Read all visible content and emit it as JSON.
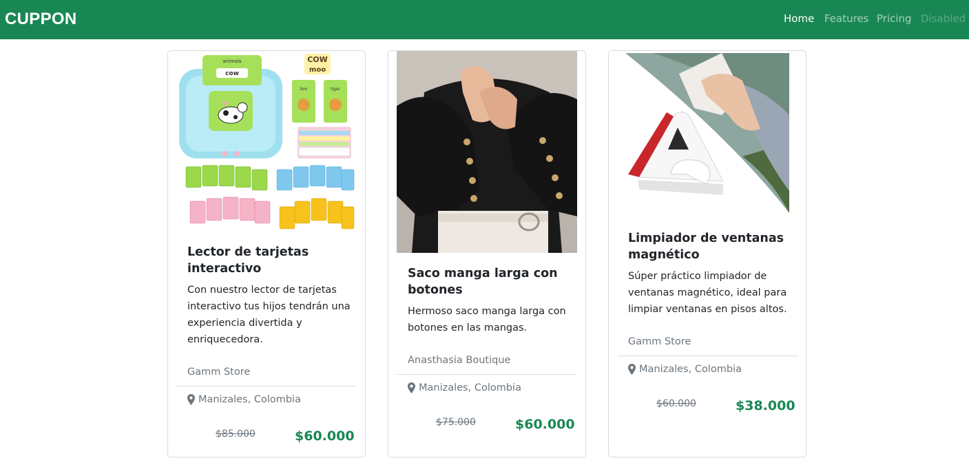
{
  "navbar": {
    "brand": "CUPPON",
    "links": [
      "Home",
      "Features",
      "Pricing",
      "Disabled"
    ]
  },
  "colors": {
    "brand_green": "#198754",
    "muted": "#6c757d"
  },
  "cards": [
    {
      "image_alt": "interactive flash card reader toy",
      "title": "Lector de tarjetas interactivo",
      "description": "Con nuestro lector de tarjetas interactivo tus hijos tendrán una experiencia divertida y enriquecedora.",
      "store": "Gamm Store",
      "location": "Manizales, Colombia",
      "old_price": "$85.000",
      "price": "$60.000",
      "image_text": {
        "card_word": "cow",
        "card_header": "animals",
        "banner_top": "COW",
        "banner_bottom": "moo",
        "card_left": "lion",
        "card_right": "tiger"
      }
    },
    {
      "image_alt": "black long sleeve cardigan with buttons",
      "title": "Saco manga larga con botones",
      "description": "Hermoso saco manga larga con botones en las mangas.",
      "store": "Anasthasia Boutique",
      "location": "Manizales, Colombia",
      "old_price": "$75.000",
      "price": "$60.000"
    },
    {
      "image_alt": "magnetic window cleaner",
      "title": "Limpiador de ventanas magnético",
      "description": "Súper práctico limpiador de ventanas magnético, ideal para limpiar ventanas en pisos altos.",
      "store": "Gamm Store",
      "location": "Manizales, Colombia",
      "old_price": "$60.000",
      "price": "$38.000"
    }
  ]
}
